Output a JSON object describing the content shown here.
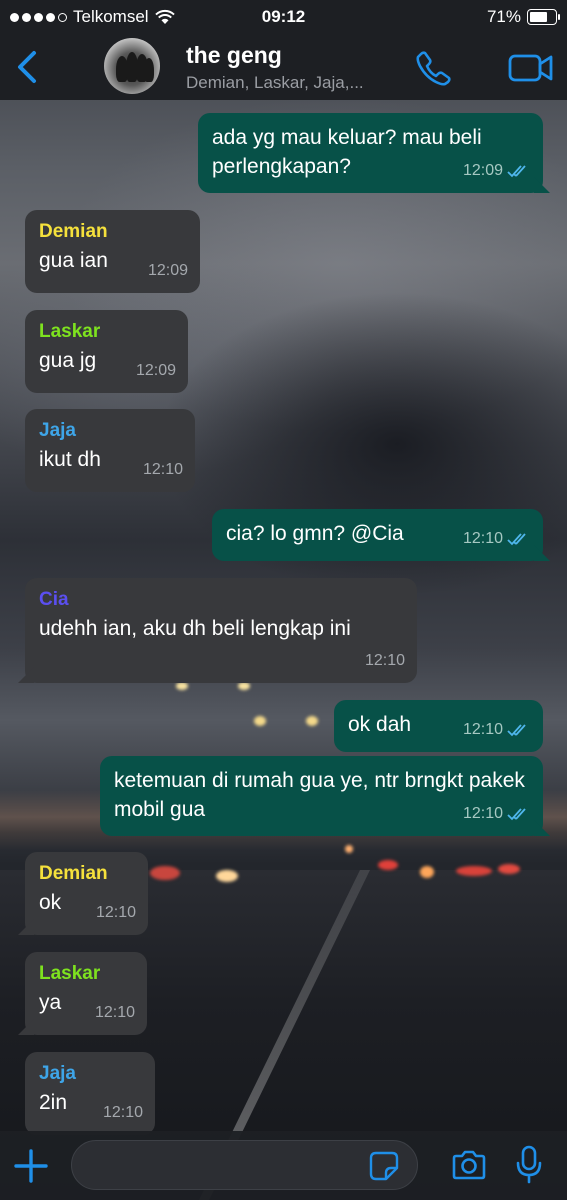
{
  "status_bar": {
    "carrier": "Telkomsel",
    "time": "09:12",
    "battery": "71%",
    "signal_bars_filled": 4,
    "battery_level": 0.71
  },
  "header": {
    "back_icon": "chevron-left-icon",
    "title": "the geng",
    "subtitle": "Demian, Laskar, Jaja,...",
    "call_icon": "phone-icon",
    "video_icon": "video-camera-icon"
  },
  "colors": {
    "accent": "#1f8fe8",
    "outgoing_bubble": "#075148",
    "incoming_bubble": "#38393c",
    "read_ticks": "#4fb6ec"
  },
  "senders": {
    "Demian": "#f5e13c",
    "Laskar": "#7ee21f",
    "Jaja": "#3ea5e8",
    "Cia": "#5b4ff0"
  },
  "messages": [
    {
      "dir": "out",
      "text": "ada yg mau keluar? mau beli perlengkapan?",
      "time": "12:09",
      "status": "read"
    },
    {
      "dir": "in",
      "sender": "Demian",
      "text": "gua ian",
      "time": "12:09"
    },
    {
      "dir": "in",
      "sender": "Laskar",
      "text": "gua jg",
      "time": "12:09"
    },
    {
      "dir": "in",
      "sender": "Jaja",
      "text": "ikut dh",
      "time": "12:10"
    },
    {
      "dir": "out",
      "text": "cia? lo gmn? @Cia",
      "time": "12:10",
      "status": "read"
    },
    {
      "dir": "in",
      "sender": "Cia",
      "text": "udehh ian, aku dh beli lengkap ini",
      "time": "12:10"
    },
    {
      "dir": "out",
      "text": "ok dah",
      "time": "12:10",
      "status": "read"
    },
    {
      "dir": "out",
      "text": "ketemuan di rumah gua ye, ntr brngkt pakek mobil gua",
      "time": "12:10",
      "status": "read"
    },
    {
      "dir": "in",
      "sender": "Demian",
      "text": "ok",
      "time": "12:10"
    },
    {
      "dir": "in",
      "sender": "Laskar",
      "text": "ya",
      "time": "12:10"
    },
    {
      "dir": "in",
      "sender": "Jaja",
      "text": "2in",
      "time": "12:10"
    }
  ],
  "input_bar": {
    "plus_icon": "plus-icon",
    "placeholder": "",
    "sticker_icon": "sticker-icon",
    "camera_icon": "camera-icon",
    "mic_icon": "microphone-icon"
  }
}
